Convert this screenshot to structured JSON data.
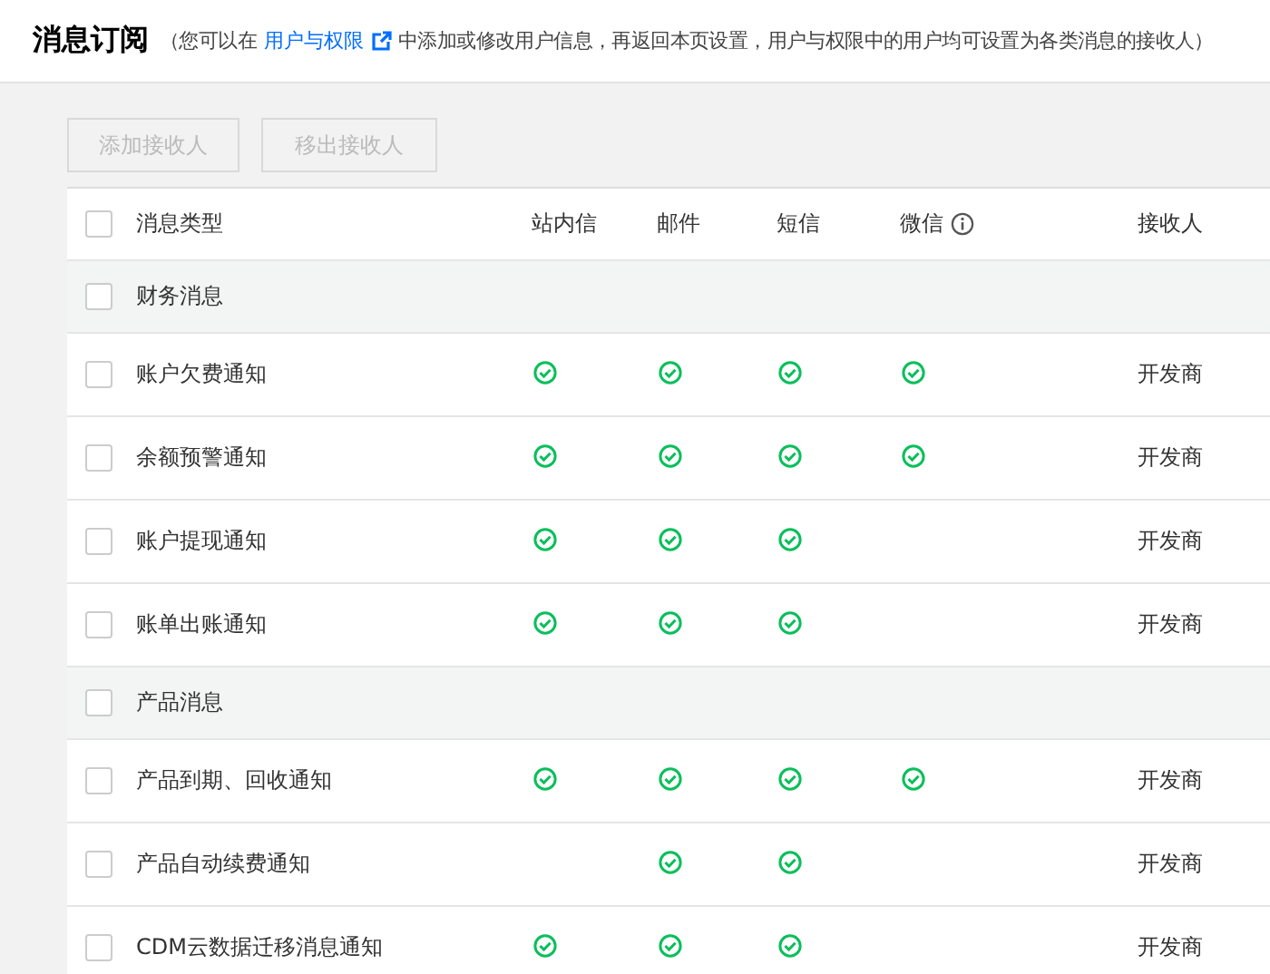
{
  "header": {
    "title": "消息订阅",
    "note_before": "（您可以在",
    "link": "用户与权限",
    "note_after": "中添加或修改用户信息，再返回本页设置，用户与权限中的用户均可设置为各类消息的接收人）"
  },
  "buttons": [
    {
      "label": "添加接收人",
      "disabled": true
    },
    {
      "label": "移出接收人",
      "disabled": true
    }
  ],
  "table": {
    "select_all": {
      "checked": false
    },
    "columns": [
      "消息类型",
      "站内信",
      "邮件",
      "短信",
      "微信",
      "接收人"
    ],
    "rows": [
      {
        "kind": "group",
        "checked": false,
        "name": "财务消息"
      },
      {
        "kind": "message",
        "checked": false,
        "name": "账户欠费通知",
        "site": true,
        "email": true,
        "sms": true,
        "wechat": true,
        "receiver": "开发商"
      },
      {
        "kind": "message",
        "checked": false,
        "name": "余额预警通知",
        "site": true,
        "email": true,
        "sms": true,
        "wechat": true,
        "receiver": "开发商"
      },
      {
        "kind": "message",
        "checked": false,
        "name": "账户提现通知",
        "site": true,
        "email": true,
        "sms": true,
        "wechat": false,
        "receiver": "开发商"
      },
      {
        "kind": "message",
        "checked": false,
        "name": "账单出账通知",
        "site": true,
        "email": true,
        "sms": true,
        "wechat": false,
        "receiver": "开发商"
      },
      {
        "kind": "group",
        "checked": false,
        "name": "产品消息"
      },
      {
        "kind": "message",
        "checked": false,
        "name": "产品到期、回收通知",
        "site": true,
        "email": true,
        "sms": true,
        "wechat": true,
        "receiver": "开发商"
      },
      {
        "kind": "message",
        "checked": false,
        "name": "产品自动续费通知",
        "site": false,
        "email": true,
        "sms": true,
        "wechat": false,
        "receiver": "开发商"
      },
      {
        "kind": "message",
        "checked": false,
        "name": "CDM云数据迁移消息通知",
        "site": true,
        "email": true,
        "sms": true,
        "wechat": false,
        "receiver": "开发商"
      }
    ]
  }
}
